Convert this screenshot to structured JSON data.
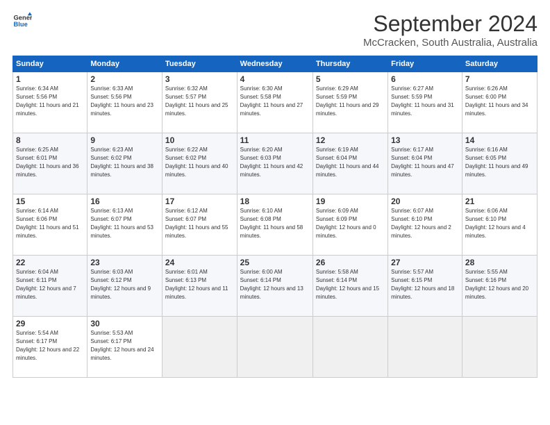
{
  "logo": {
    "line1": "General",
    "line2": "Blue"
  },
  "title": "September 2024",
  "subtitle": "McCracken, South Australia, Australia",
  "header_days": [
    "Sunday",
    "Monday",
    "Tuesday",
    "Wednesday",
    "Thursday",
    "Friday",
    "Saturday"
  ],
  "weeks": [
    [
      {
        "day": "1",
        "sunrise": "6:34 AM",
        "sunset": "5:56 PM",
        "daylight": "11 hours and 21 minutes."
      },
      {
        "day": "2",
        "sunrise": "6:33 AM",
        "sunset": "5:56 PM",
        "daylight": "11 hours and 23 minutes."
      },
      {
        "day": "3",
        "sunrise": "6:32 AM",
        "sunset": "5:57 PM",
        "daylight": "11 hours and 25 minutes."
      },
      {
        "day": "4",
        "sunrise": "6:30 AM",
        "sunset": "5:58 PM",
        "daylight": "11 hours and 27 minutes."
      },
      {
        "day": "5",
        "sunrise": "6:29 AM",
        "sunset": "5:59 PM",
        "daylight": "11 hours and 29 minutes."
      },
      {
        "day": "6",
        "sunrise": "6:27 AM",
        "sunset": "5:59 PM",
        "daylight": "11 hours and 31 minutes."
      },
      {
        "day": "7",
        "sunrise": "6:26 AM",
        "sunset": "6:00 PM",
        "daylight": "11 hours and 34 minutes."
      }
    ],
    [
      {
        "day": "8",
        "sunrise": "6:25 AM",
        "sunset": "6:01 PM",
        "daylight": "11 hours and 36 minutes."
      },
      {
        "day": "9",
        "sunrise": "6:23 AM",
        "sunset": "6:02 PM",
        "daylight": "11 hours and 38 minutes."
      },
      {
        "day": "10",
        "sunrise": "6:22 AM",
        "sunset": "6:02 PM",
        "daylight": "11 hours and 40 minutes."
      },
      {
        "day": "11",
        "sunrise": "6:20 AM",
        "sunset": "6:03 PM",
        "daylight": "11 hours and 42 minutes."
      },
      {
        "day": "12",
        "sunrise": "6:19 AM",
        "sunset": "6:04 PM",
        "daylight": "11 hours and 44 minutes."
      },
      {
        "day": "13",
        "sunrise": "6:17 AM",
        "sunset": "6:04 PM",
        "daylight": "11 hours and 47 minutes."
      },
      {
        "day": "14",
        "sunrise": "6:16 AM",
        "sunset": "6:05 PM",
        "daylight": "11 hours and 49 minutes."
      }
    ],
    [
      {
        "day": "15",
        "sunrise": "6:14 AM",
        "sunset": "6:06 PM",
        "daylight": "11 hours and 51 minutes."
      },
      {
        "day": "16",
        "sunrise": "6:13 AM",
        "sunset": "6:07 PM",
        "daylight": "11 hours and 53 minutes."
      },
      {
        "day": "17",
        "sunrise": "6:12 AM",
        "sunset": "6:07 PM",
        "daylight": "11 hours and 55 minutes."
      },
      {
        "day": "18",
        "sunrise": "6:10 AM",
        "sunset": "6:08 PM",
        "daylight": "11 hours and 58 minutes."
      },
      {
        "day": "19",
        "sunrise": "6:09 AM",
        "sunset": "6:09 PM",
        "daylight": "12 hours and 0 minutes."
      },
      {
        "day": "20",
        "sunrise": "6:07 AM",
        "sunset": "6:10 PM",
        "daylight": "12 hours and 2 minutes."
      },
      {
        "day": "21",
        "sunrise": "6:06 AM",
        "sunset": "6:10 PM",
        "daylight": "12 hours and 4 minutes."
      }
    ],
    [
      {
        "day": "22",
        "sunrise": "6:04 AM",
        "sunset": "6:11 PM",
        "daylight": "12 hours and 7 minutes."
      },
      {
        "day": "23",
        "sunrise": "6:03 AM",
        "sunset": "6:12 PM",
        "daylight": "12 hours and 9 minutes."
      },
      {
        "day": "24",
        "sunrise": "6:01 AM",
        "sunset": "6:13 PM",
        "daylight": "12 hours and 11 minutes."
      },
      {
        "day": "25",
        "sunrise": "6:00 AM",
        "sunset": "6:14 PM",
        "daylight": "12 hours and 13 minutes."
      },
      {
        "day": "26",
        "sunrise": "5:58 AM",
        "sunset": "6:14 PM",
        "daylight": "12 hours and 15 minutes."
      },
      {
        "day": "27",
        "sunrise": "5:57 AM",
        "sunset": "6:15 PM",
        "daylight": "12 hours and 18 minutes."
      },
      {
        "day": "28",
        "sunrise": "5:55 AM",
        "sunset": "6:16 PM",
        "daylight": "12 hours and 20 minutes."
      }
    ],
    [
      {
        "day": "29",
        "sunrise": "5:54 AM",
        "sunset": "6:17 PM",
        "daylight": "12 hours and 22 minutes."
      },
      {
        "day": "30",
        "sunrise": "5:53 AM",
        "sunset": "6:17 PM",
        "daylight": "12 hours and 24 minutes."
      },
      null,
      null,
      null,
      null,
      null
    ]
  ],
  "labels": {
    "sunrise": "Sunrise:",
    "sunset": "Sunset:",
    "daylight": "Daylight:"
  }
}
